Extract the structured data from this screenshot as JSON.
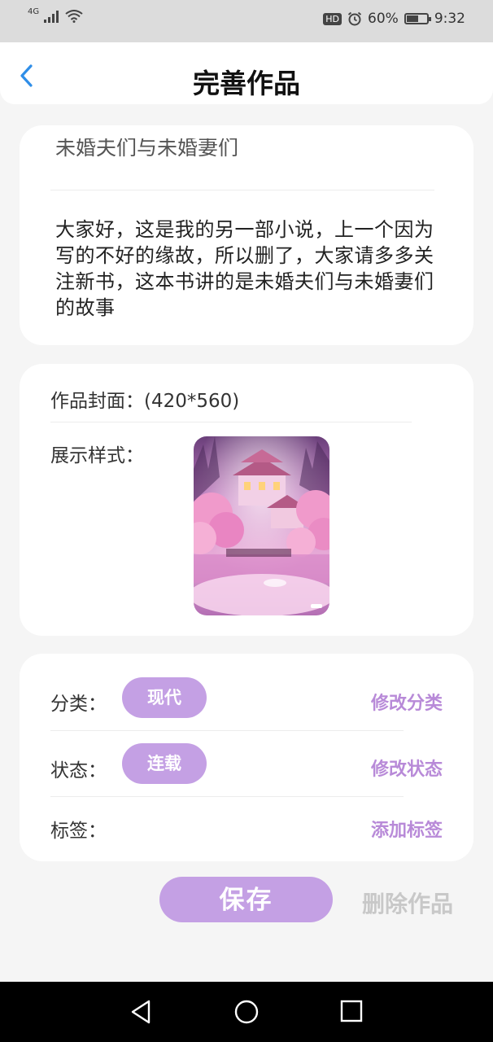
{
  "status_bar": {
    "network": "4G",
    "hd_badge": "HD",
    "battery_text": "60%",
    "battery_level": 0.6,
    "time": "9:32"
  },
  "header": {
    "title": "完善作品",
    "back_icon": "chevron-left-icon"
  },
  "intro_card": {
    "title": "未婚夫们与未婚妻们",
    "description": "大家好，这是我的另一部小说，上一个因为写的不好的缘故，所以删了，大家请多多关注新书，这本书讲的是未婚夫们与未婚妻们的故事"
  },
  "cover_card": {
    "cover_label": "作品封面：(420*560)",
    "display_label": "展示样式："
  },
  "meta_card": {
    "category_label": "分类：",
    "category_value": "现代",
    "category_action": "修改分类",
    "status_label": "状态：",
    "status_value": "连载",
    "status_action": "修改状态",
    "tags_label": "标签：",
    "tags_action": "添加标签"
  },
  "actions": {
    "save": "保存",
    "delete": "删除作品"
  },
  "system_nav": {
    "back_icon": "triangle-back-icon",
    "home_icon": "circle-home-icon",
    "recents_icon": "square-recents-icon"
  },
  "colors": {
    "accent": "#c4a0e4",
    "link": "#b88ad8",
    "back_arrow": "#2f8ee8",
    "disabled": "#c8c8c8"
  }
}
